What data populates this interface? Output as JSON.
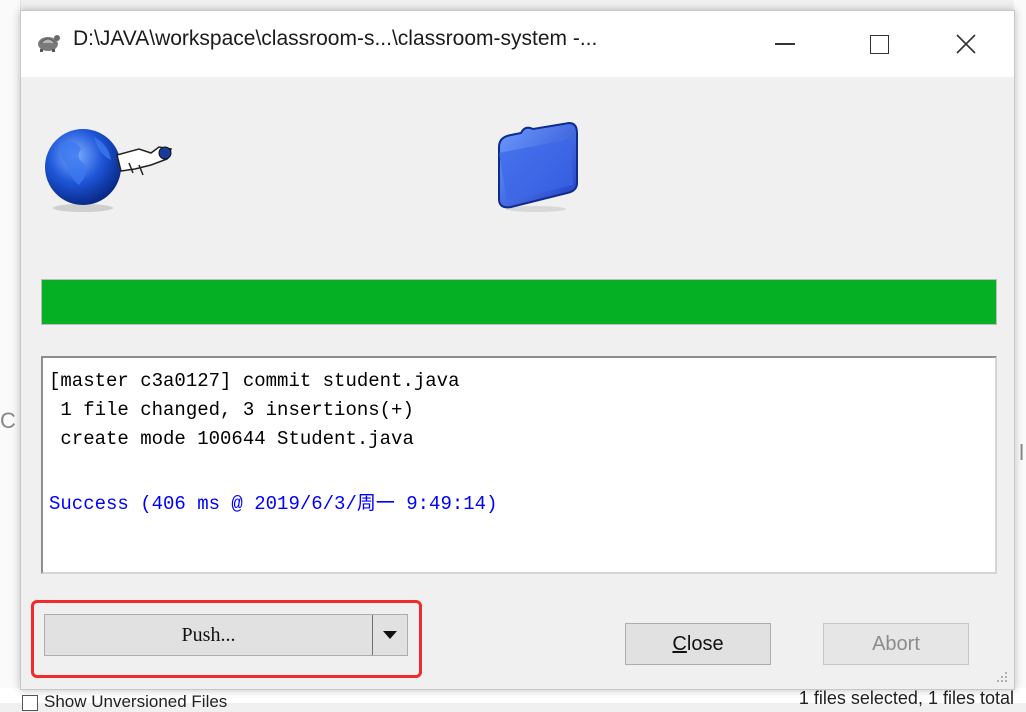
{
  "window": {
    "title": "D:\\JAVA\\workspace\\classroom-s...\\classroom-system -...",
    "icon": "tortoise-icon"
  },
  "progress": {
    "fraction": 1.0,
    "color": "#06b025"
  },
  "log": {
    "lines": [
      "[master c3a0127] commit student.java",
      " 1 file changed, 3 insertions(+)",
      " create mode 100644 Student.java"
    ],
    "success": "Success (406 ms @ 2019/6/3/周一 9:49:14)",
    "success_color": "#0000ff"
  },
  "buttons": {
    "push": "Push...",
    "close": "Close",
    "abort": "Abort"
  },
  "background": {
    "left_char": "C",
    "right_char": "l",
    "checkbox_label": "Show Unversioned Files",
    "status": "1 files selected, 1 files total"
  },
  "highlight_color": "#ef2b2b"
}
